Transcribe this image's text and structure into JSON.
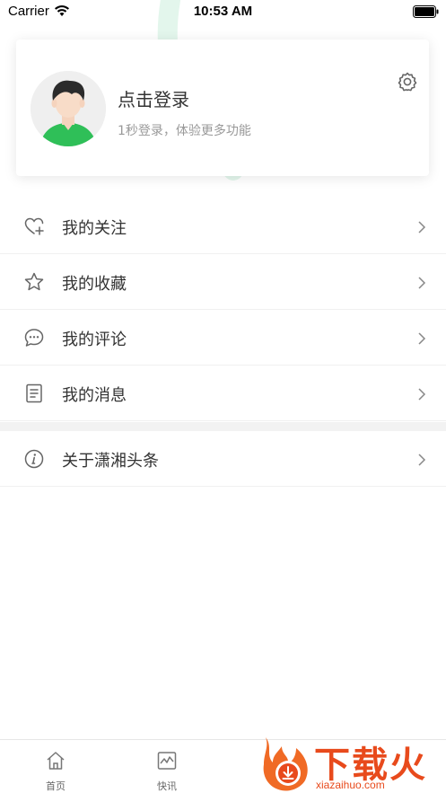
{
  "status_bar": {
    "carrier": "Carrier",
    "time": "10:53 AM"
  },
  "profile": {
    "title": "点击登录",
    "subtitle": "1秒登录，体验更多功能",
    "icon": "gear-icon"
  },
  "menu": {
    "items": [
      {
        "label": "我的关注",
        "icon": "heart-plus-icon"
      },
      {
        "label": "我的收藏",
        "icon": "star-icon"
      },
      {
        "label": "我的评论",
        "icon": "chat-bubble-icon"
      },
      {
        "label": "我的消息",
        "icon": "document-icon"
      }
    ],
    "about": {
      "label": "关于潇湘头条",
      "icon": "info-icon"
    }
  },
  "tab_bar": {
    "tabs": [
      {
        "label": "首页",
        "icon": "home-icon"
      },
      {
        "label": "快讯",
        "icon": "chart-pulse-icon"
      }
    ]
  },
  "watermark": {
    "text": "下载火",
    "url": "xiazaihuo.com"
  },
  "colors": {
    "accent_green": "#2fbf71",
    "text": "#333333",
    "muted": "#999999",
    "watermark": "#e84a1c"
  }
}
